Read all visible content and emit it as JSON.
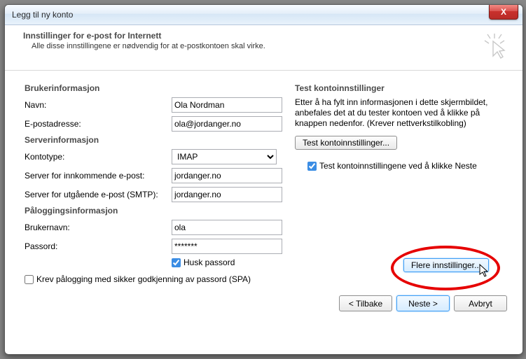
{
  "window": {
    "title": "Legg til ny konto",
    "close_symbol": "X"
  },
  "header": {
    "title": "Innstillinger for e-post for Internett",
    "subtitle": "Alle disse innstillingene er nødvendig for at e-postkontoen skal virke."
  },
  "sections": {
    "user_info": "Brukerinformasjon",
    "server_info": "Serverinformasjon",
    "login_info": "Påloggingsinformasjon"
  },
  "fields": {
    "name_label": "Navn:",
    "name_value": "Ola Nordman",
    "email_label": "E-postadresse:",
    "email_value": "ola@jordanger.no",
    "account_type_label": "Kontotype:",
    "account_type_value": "IMAP",
    "incoming_label": "Server for innkommende e-post:",
    "incoming_value": "jordanger.no",
    "outgoing_label": "Server for utgående e-post (SMTP):",
    "outgoing_value": "jordanger.no",
    "username_label": "Brukernavn:",
    "username_value": "ola",
    "password_label": "Passord:",
    "password_value": "*******",
    "remember_password": "Husk passord",
    "spa_label": "Krev pålogging med sikker godkjenning av passord (SPA)"
  },
  "test_panel": {
    "heading": "Test kontoinnstillinger",
    "description": "Etter å ha fylt inn informasjonen i dette skjermbildet, anbefales det at du tester kontoen ved å klikke på knappen nedenfor. (Krever nettverkstilkobling)",
    "test_button": "Test kontoinnstillinger...",
    "test_on_next": "Test kontoinnstillingene ved å klikke Neste"
  },
  "buttons": {
    "more_settings": "Flere innstillinger...",
    "back": "< Tilbake",
    "next": "Neste >",
    "cancel": "Avbryt"
  }
}
